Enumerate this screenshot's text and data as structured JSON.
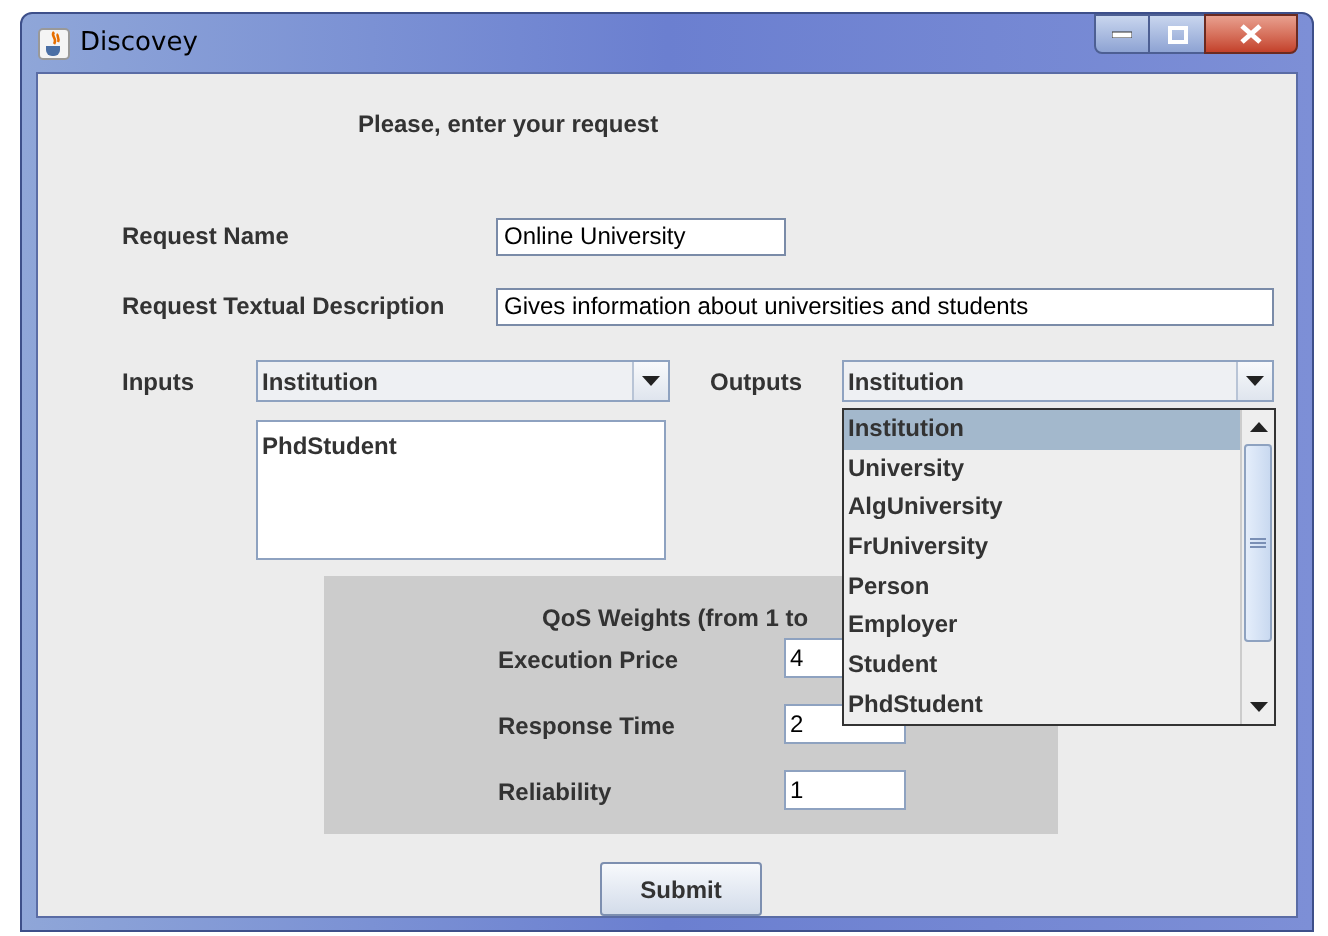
{
  "window": {
    "title": "Discovey"
  },
  "heading": "Please, enter your request",
  "request_name": {
    "label": "Request Name",
    "value": "Online University"
  },
  "request_description": {
    "label": "Request Textual Description",
    "value": "Gives information about universities and students"
  },
  "inputs": {
    "label": "Inputs",
    "selected_value": "Institution",
    "list": [
      "PhdStudent"
    ]
  },
  "outputs": {
    "label": "Outputs",
    "selected_value": "Institution",
    "open": true,
    "options": [
      {
        "label": "Institution",
        "selected": true
      },
      {
        "label": "University",
        "selected": false
      },
      {
        "label": "AlgUniversity",
        "selected": false
      },
      {
        "label": "FrUniversity",
        "selected": false
      },
      {
        "label": "Person",
        "selected": false
      },
      {
        "label": "Employer",
        "selected": false
      },
      {
        "label": "Student",
        "selected": false
      },
      {
        "label": "PhdStudent",
        "selected": false
      }
    ]
  },
  "qos": {
    "title": "QoS Weights (from 1 to",
    "weights": [
      {
        "label": "Execution Price",
        "value": "4"
      },
      {
        "label": "Response Time",
        "value": "2"
      },
      {
        "label": "Reliability",
        "value": "1"
      }
    ]
  },
  "submit_button": "Submit"
}
